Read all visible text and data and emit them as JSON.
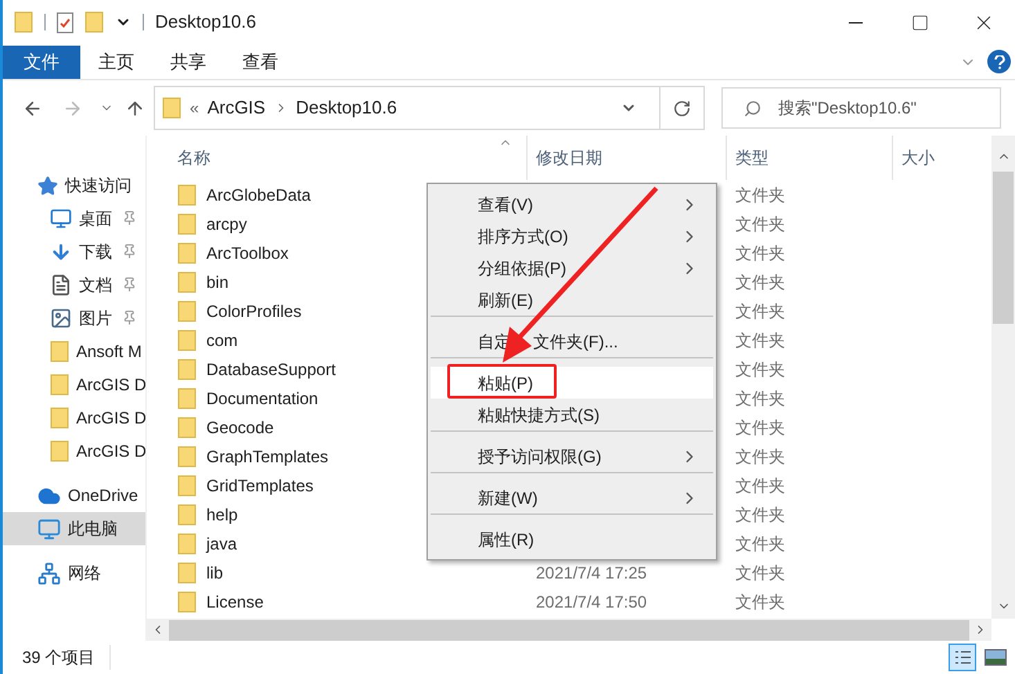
{
  "window": {
    "title": "Desktop10.6"
  },
  "ribbon_tabs": [
    {
      "label": "文件",
      "selected": true
    },
    {
      "label": "主页",
      "selected": false
    },
    {
      "label": "共享",
      "selected": false
    },
    {
      "label": "查看",
      "selected": false
    }
  ],
  "address_bar": {
    "overflow": "«",
    "path": [
      "ArcGIS",
      "Desktop10.6"
    ]
  },
  "search": {
    "placeholder": "搜索\"Desktop10.6\""
  },
  "sidebar": {
    "items": [
      {
        "label": "快速访问",
        "kind": "star",
        "pinned": false,
        "selected": false,
        "children": [
          {
            "label": "桌面",
            "kind": "desktop",
            "pinned": true,
            "selected": false
          },
          {
            "label": "下载",
            "kind": "download",
            "pinned": true,
            "selected": false
          },
          {
            "label": "文档",
            "kind": "document",
            "pinned": true,
            "selected": false
          },
          {
            "label": "图片",
            "kind": "picture",
            "pinned": true,
            "selected": false
          },
          {
            "label": "Ansoft M",
            "kind": "folder",
            "pinned": false,
            "selected": false
          },
          {
            "label": "ArcGIS D",
            "kind": "folder",
            "pinned": false,
            "selected": false
          },
          {
            "label": "ArcGIS D",
            "kind": "folder",
            "pinned": false,
            "selected": false
          },
          {
            "label": "ArcGIS D",
            "kind": "folder",
            "pinned": false,
            "selected": false
          }
        ]
      },
      {
        "label": "OneDrive",
        "kind": "cloud",
        "pinned": false,
        "selected": false
      },
      {
        "label": "此电脑",
        "kind": "computer",
        "pinned": false,
        "selected": true
      },
      {
        "label": "网络",
        "kind": "network",
        "pinned": false,
        "selected": false
      }
    ]
  },
  "table": {
    "columns": [
      "名称",
      "修改日期",
      "类型",
      "大小"
    ],
    "rows": [
      {
        "name": "ArcGlobeData",
        "type": "文件夹"
      },
      {
        "name": "arcpy",
        "type": "文件夹"
      },
      {
        "name": "ArcToolbox",
        "type": "文件夹"
      },
      {
        "name": "bin",
        "type": "文件夹"
      },
      {
        "name": "ColorProfiles",
        "type": "文件夹"
      },
      {
        "name": "com",
        "type": "文件夹"
      },
      {
        "name": "DatabaseSupport",
        "type": "文件夹"
      },
      {
        "name": "Documentation",
        "type": "文件夹"
      },
      {
        "name": "Geocode",
        "type": "文件夹"
      },
      {
        "name": "GraphTemplates",
        "type": "文件夹"
      },
      {
        "name": "GridTemplates",
        "type": "文件夹"
      },
      {
        "name": "help",
        "type": "文件夹"
      },
      {
        "name": "java",
        "type": "文件夹"
      },
      {
        "name": "lib",
        "date": "2021/7/4 17:25",
        "type": "文件夹"
      },
      {
        "name": "License",
        "date": "2021/7/4 17:50",
        "type": "文件夹"
      }
    ]
  },
  "context_menu": {
    "items": [
      {
        "label": "查看(V)",
        "submenu": true,
        "highlighted": false,
        "separator_after": false
      },
      {
        "label": "排序方式(O)",
        "submenu": true,
        "highlighted": false,
        "separator_after": false
      },
      {
        "label": "分组依据(P)",
        "submenu": true,
        "highlighted": false,
        "separator_after": false
      },
      {
        "label": "刷新(E)",
        "submenu": false,
        "highlighted": false,
        "separator_after": true
      },
      {
        "label": "自定",
        "label_rest": "文件夹(F)...",
        "submenu": false,
        "highlighted": false,
        "separator_after": true
      },
      {
        "label": "粘贴(P)",
        "submenu": false,
        "highlighted": true,
        "separator_after": false
      },
      {
        "label": "粘贴快捷方式(S)",
        "submenu": false,
        "highlighted": false,
        "separator_after": true
      },
      {
        "label": "授予访问权限(G)",
        "submenu": true,
        "highlighted": false,
        "separator_after": true
      },
      {
        "label": "新建(W)",
        "submenu": true,
        "highlighted": false,
        "separator_after": true
      },
      {
        "label": "属性(R)",
        "submenu": false,
        "highlighted": false,
        "separator_after": false
      }
    ]
  },
  "status_bar": {
    "count": "39 个项目"
  }
}
